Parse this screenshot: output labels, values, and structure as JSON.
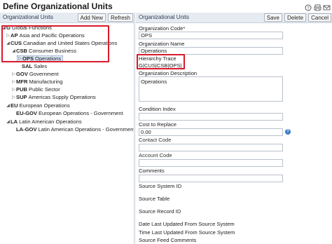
{
  "page": {
    "title": "Define Organizational Units"
  },
  "left_panel": {
    "header": "Organizational Units",
    "add_new_label": "Add New",
    "refresh_label": "Refresh",
    "tree": [
      {
        "code": "G",
        "name": "Global Functions",
        "toggle": "expanded"
      },
      {
        "code": "AP",
        "name": "Asia and Pacific Operations",
        "toggle": "collapsed"
      },
      {
        "code": "CUS",
        "name": "Canadian and United States Operations",
        "toggle": "expanded"
      },
      {
        "code": "CSB",
        "name": "Consumer Business",
        "toggle": "expanded"
      },
      {
        "code": "OPS",
        "name": "Operations",
        "toggle": "collapsed",
        "selected": true
      },
      {
        "code": "SAL",
        "name": "Sales",
        "toggle": "none"
      },
      {
        "code": "GOV",
        "name": "Government",
        "toggle": "collapsed"
      },
      {
        "code": "MFR",
        "name": "Manufacturing",
        "toggle": "collapsed"
      },
      {
        "code": "PUB",
        "name": "Public Sector",
        "toggle": "collapsed"
      },
      {
        "code": "SUP",
        "name": "Americas Supply Operations",
        "toggle": "collapsed"
      },
      {
        "code": "EU",
        "name": "European Operations",
        "toggle": "expanded"
      },
      {
        "code": "EU-GOV",
        "name": "European Operations - Government",
        "toggle": "none"
      },
      {
        "code": "LA",
        "name": "Latin American Operations",
        "toggle": "expanded"
      },
      {
        "code": "LA-GOV",
        "name": "Latin American Operations - Government",
        "toggle": "none"
      }
    ]
  },
  "right_panel": {
    "header": "Organizational Units",
    "save_label": "Save",
    "delete_label": "Delete",
    "cancel_label": "Cancel",
    "org_code_label": "Organization Code*",
    "org_code_value": "OPS",
    "org_name_label": "Organization Name",
    "org_name_value": "Operations",
    "hierarchy_trace_label": "Hierarchy Trace",
    "hierarchy_trace_value": "G|CUS|CSB|OPS|",
    "org_desc_label": "Organization Description",
    "org_desc_value": "Operations",
    "condition_index_label": "Condition Index",
    "condition_index_value": "",
    "cost_to_replace_label": "Cost to Replace",
    "cost_to_replace_value": "0.00",
    "info_icon_glyph": "?",
    "contact_code_label": "Contact Code",
    "contact_code_value": "",
    "account_code_label": "Account Code",
    "account_code_value": "",
    "comments_label": "Comments",
    "comments_value": "",
    "source_system_id_label": "Source System ID",
    "source_table_label": "Source Table",
    "source_record_id_label": "Source Record ID",
    "date_last_updated_label": "Date Last Updated From Source System",
    "time_last_updated_label": "Time Last Updated From Source System",
    "source_feed_comments_label": "Source Feed Comments"
  },
  "colors": {
    "highlight": "#d9192b",
    "header_bg": "#e6ebf2",
    "selected_bg": "#d9e6f6",
    "info_blue": "#3a7dc9"
  },
  "icons": [
    "print-icon",
    "email-icon",
    "help-icon"
  ]
}
